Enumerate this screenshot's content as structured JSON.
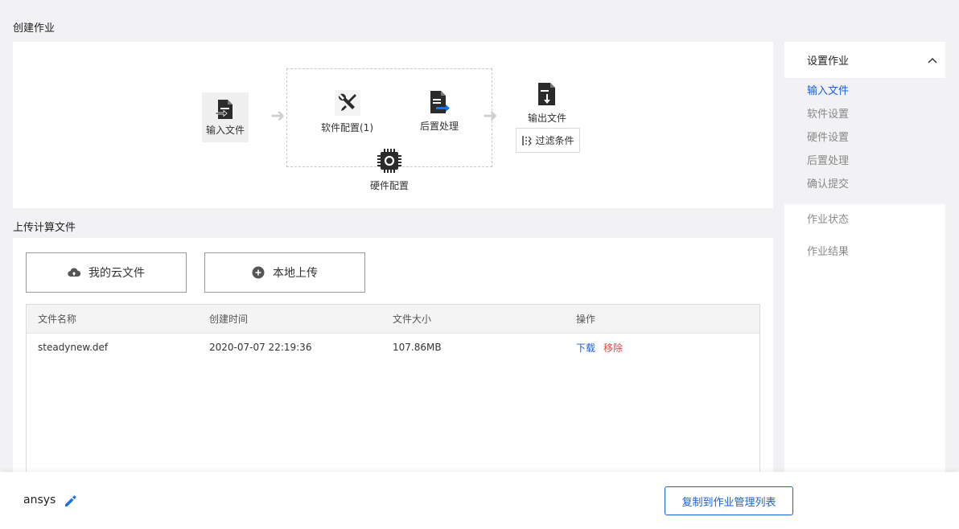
{
  "page": {
    "create_title": "创建作业",
    "upload_title": "上传计算文件"
  },
  "workflow": {
    "input_label": "输入文件",
    "software_label": "软件配置(1)",
    "post_label": "后置处理",
    "hardware_label": "硬件配置",
    "output_label": "输出文件",
    "filter_label": "过滤条件"
  },
  "upload": {
    "cloud_label": "我的云文件",
    "local_label": "本地上传"
  },
  "table": {
    "headers": [
      "文件名称",
      "创建时间",
      "文件大小",
      "操作"
    ],
    "rows": [
      {
        "name": "steadynew.def",
        "created": "2020-07-07 22:19:36",
        "size": "107.86MB",
        "download": "下载",
        "remove": "移除"
      }
    ]
  },
  "sidebar": {
    "header": "设置作业",
    "sub_items": [
      "输入文件",
      "软件设置",
      "硬件设置",
      "后置处理",
      "确认提交"
    ],
    "items": [
      "作业状态",
      "作业结果"
    ]
  },
  "footer": {
    "job_name": "ansys",
    "copy_label": "复制到作业管理列表"
  },
  "colors": {
    "accent": "#1a5fd6",
    "danger": "#e8433e"
  }
}
